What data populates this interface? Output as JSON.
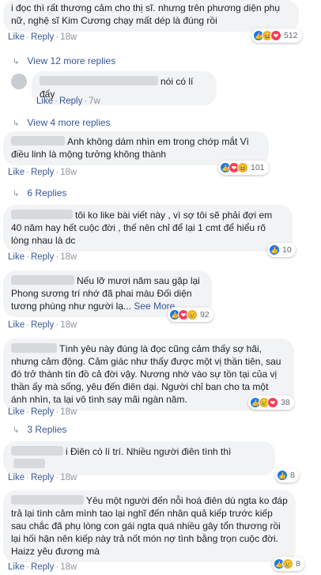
{
  "comments": [
    {
      "text": "i đọc thì rất thương cảm cho thị sĩ. nhưng trên phương diện phụ nữ, nghệ sĩ Kim Cương chạy mất dép là đúng rồi",
      "time": "18w",
      "reactions": [
        "like",
        "haha",
        "love"
      ],
      "reaction_count": "512",
      "replies_label": "View 12 more replies"
    },
    {
      "text": "nói có lí đấy",
      "time": "7w",
      "is_reply": true,
      "replies_label": "View 4 more replies"
    },
    {
      "text": "Anh không dám nhìn em trong chớp mắt Vì điều linh là mộng tưởng không thành",
      "time": "18w",
      "reactions": [
        "like",
        "love",
        "haha"
      ],
      "reaction_count": "101",
      "replies_label": "6 Replies"
    },
    {
      "text": "tôi ko like bài viết này , vì sợ tôi sẽ phải đợi em 40 năm hay hết cuộc đời , thế nên chỉ để lại 1 cmt để hiểu rõ lòng nhau là dc",
      "time": "18w",
      "reactions": [
        "like"
      ],
      "reaction_count": "10"
    },
    {
      "text": "Nếu lỡ mươi năm sau gặp lại Phong sương trí nhớ đã phai màu Đối diện tương phùng như người lạ...",
      "see_more": "See More",
      "time": "18w",
      "reactions": [
        "like",
        "love",
        "sad"
      ],
      "reaction_count": "92"
    },
    {
      "text": "Tình yêu này đúng là đọc cũng cảm thấy sợ hãi, nhưng cảm động. Cảm giác như thấy được một vị thần tiên, sau đó trở thành tín đồ cả đời vậy. Nương nhờ vào sự tồn tại của vị thần ấy mà sống, yêu đến điên dại. Người chỉ ban cho ta một ánh nhìn, ta lại vô tình say mãi ngàn năm.",
      "time": "18w",
      "reactions": [
        "like",
        "sad",
        "love"
      ],
      "reaction_count": "38",
      "replies_label": "3 Replies"
    },
    {
      "text": "i Điên có lí trí. Nhiều người điên tình thì",
      "time": "18w",
      "reactions": [
        "like"
      ],
      "reaction_count": "8"
    },
    {
      "text": "Yêu một người đến nỗi hoá điên dù ngta ko đáp trả lại tình cảm mình tao lại nghĩ đến nhân quả kiếp trước kiếp sau chắc đã phụ lòng con gái ngta quá nhiều gây tổn thương rồi lại hối hận nên kiếp này trả nốt món nợ tình bằng trọn cuộc đời. Haizz yêu đương mà",
      "time": "18w",
      "reactions": [
        "like",
        "sad"
      ],
      "reaction_count": "8"
    }
  ],
  "labels": {
    "like": "Like",
    "reply": "Reply",
    "dot": "·"
  },
  "colors": {
    "link": "#385898",
    "bubble": "#f2f3f5",
    "muted": "#90949c"
  }
}
